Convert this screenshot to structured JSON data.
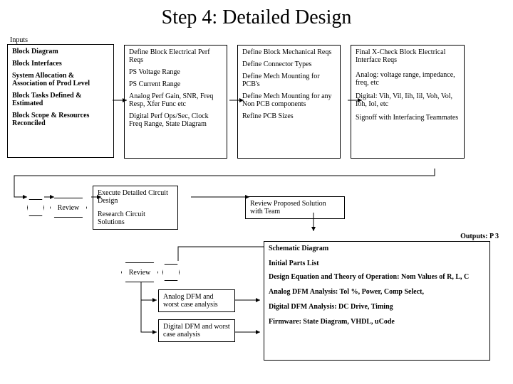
{
  "title": "Step 4:  Detailed Design",
  "inputs_label": "Inputs",
  "inputs_box": {
    "l1": "Block Diagram",
    "l2": "Block Interfaces",
    "l3": "System Allocation & Association of Prod Level",
    "l4": "Block Tasks Defined & Estimated",
    "l5": "Block Scope & Resources Reconciled"
  },
  "elec_box": {
    "h": "Define Block Electrical Perf Reqs",
    "l1": "PS Voltage Range",
    "l2": "PS Current Range",
    "l3": "Analog Perf Gain, SNR, Freq Resp, Xfer Func etc",
    "l4": "Digital Perf Ops/Sec, Clock Freq Range, State Diagram"
  },
  "mech_box": {
    "h": "Define Block Mechanical Reqs",
    "l1": "Define Connector Types",
    "l2": "Define Mech Mounting for PCB's",
    "l3": "Define Mech Mounting for any Non PCB components",
    "l4": "Refine PCB Sizes"
  },
  "xcheck_box": {
    "h": "Final X-Check Block Electrical Interface Reqs",
    "l1": "Analog:  voltage range, impedance, freq, etc",
    "l2": "Digital:  Vih, Vil, Iih, Iil, Voh, Vol, Ioh, Iol, etc",
    "l3": "Signoff with Interfacing Teammates"
  },
  "review": "Review",
  "design_box": {
    "l1": "Execute Detailed Circuit Design",
    "l2": "Research Circuit Solutions"
  },
  "review_team": "Review Proposed Solution with Team",
  "dfm1": "Analog DFM and worst case analysis",
  "dfm2": "Digital DFM and worst case analysis",
  "outputs_label": "Outputs:  P 3",
  "outputs_box": {
    "l1": "Schematic Diagram",
    "l2": "Initial Parts List",
    "l3": "Design Equation and Theory of Operation:  Nom Values of R, L, C",
    "l4": "Analog DFM Analysis:  Tol %, Power, Comp Select,",
    "l5": "Digital DFM Analysis:  DC Drive, Timing",
    "l6": "Firmware:  State Diagram, VHDL, uCode"
  }
}
